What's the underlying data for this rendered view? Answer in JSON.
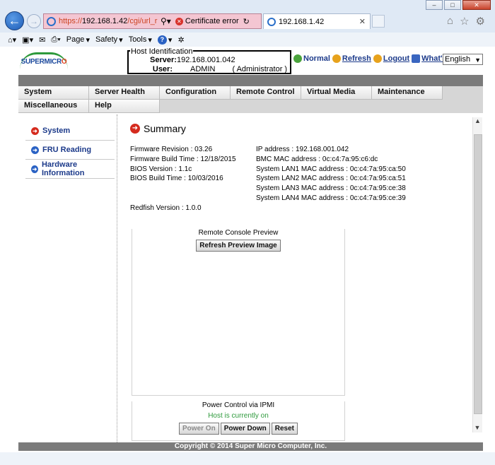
{
  "browser": {
    "url_prefix": "https://",
    "url_host": "192.168.1.42",
    "url_path": "/cgi/url_redirect.cgi?",
    "cert_error": "Certificate error",
    "tab_title": "192.168.1.42",
    "cmd": {
      "page": "Page",
      "safety": "Safety",
      "tools": "Tools"
    }
  },
  "logo": {
    "text": "SUPERMICR",
    "dot": "O"
  },
  "host": {
    "legend": "Host Identification",
    "server_label": "Server:",
    "server_value": "192.168.001.042",
    "user_label": "User:",
    "user_value": "ADMIN",
    "user_role": "( Administrator )"
  },
  "links": {
    "normal": "Normal",
    "refresh": "Refresh",
    "logout": "Logout",
    "whats_new": "What's  new"
  },
  "language": "English",
  "menu": {
    "row1": [
      "System",
      "Server Health",
      "Configuration",
      "Remote Control",
      "Virtual Media",
      "Maintenance"
    ],
    "row2": [
      "Miscellaneous",
      "Help"
    ]
  },
  "sidebar": [
    "System",
    "FRU Reading",
    "Hardware Information"
  ],
  "summary": {
    "title": "Summary",
    "left": [
      "Firmware Revision : 03.26",
      "Firmware Build Time : 12/18/2015",
      "BIOS Version : 1.1c",
      "BIOS Build Time : 10/03/2016"
    ],
    "right": [
      "IP address : 192.168.001.042",
      "BMC MAC address : 0c:c4:7a:95:c6:dc",
      "System LAN1 MAC address : 0c:c4:7a:95:ca:50",
      "System LAN2 MAC address : 0c:c4:7a:95:ca:51",
      "System LAN3 MAC address : 0c:c4:7a:95:ce:38",
      "System LAN4 MAC address : 0c:c4:7a:95:ce:39"
    ],
    "redfish": "Redfish Version : 1.0.0"
  },
  "console": {
    "title": "Remote Console Preview",
    "refresh_button": "Refresh Preview Image"
  },
  "power": {
    "title": "Power Control via IPMI",
    "status": "Host is currently on",
    "power_on": "Power On",
    "power_down": "Power Down",
    "reset": "Reset"
  },
  "footer": "Copyright © 2014 Super Micro Computer, Inc.",
  "colors": {
    "status_on": "#2e9a3c",
    "accent_red": "#d52b1e",
    "link_blue": "#1c3a8a"
  }
}
